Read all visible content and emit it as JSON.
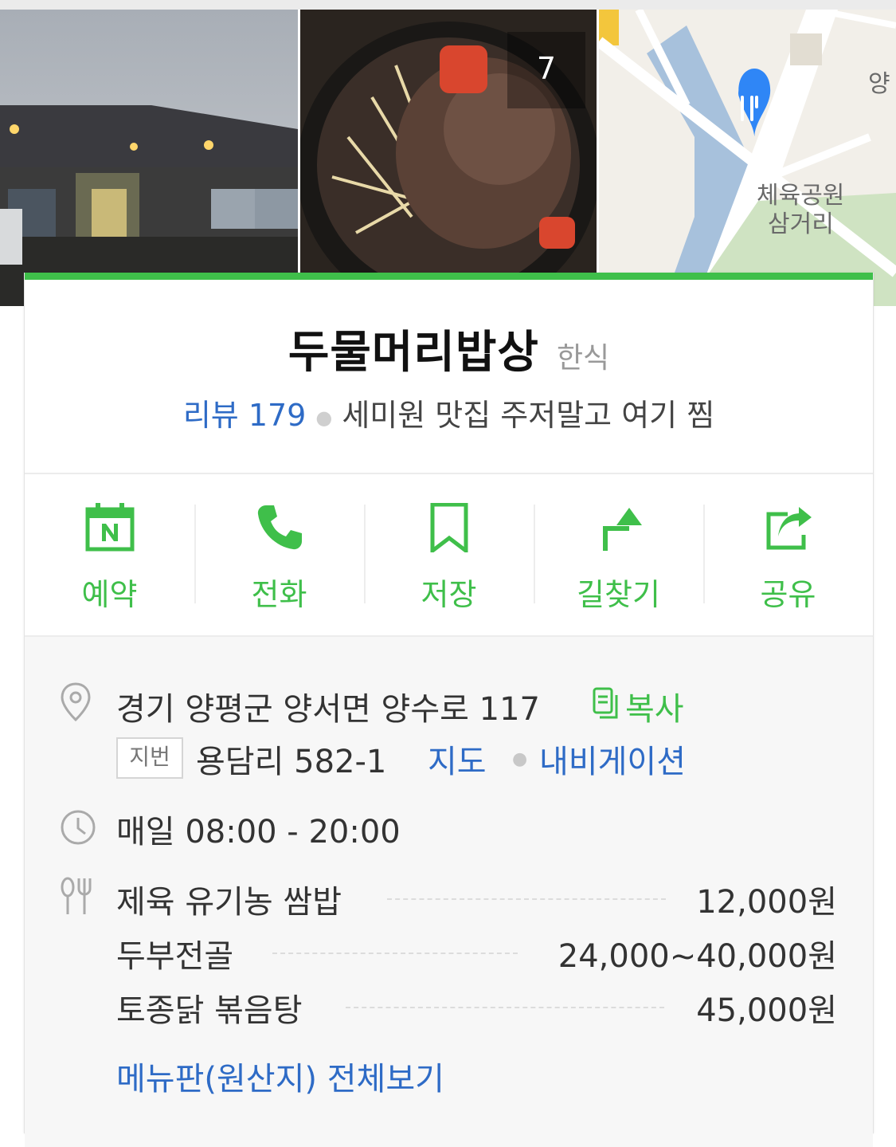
{
  "photos": {
    "count": "7",
    "map_labels": [
      "체육공원",
      "삼거리",
      "양"
    ]
  },
  "place": {
    "name": "두물머리밥상",
    "category": "한식",
    "review_link": "리뷰 179",
    "tagline": "세미원 맛집 주저말고 여기 찜"
  },
  "actions": [
    {
      "label": "예약",
      "icon": "naver-calendar-icon"
    },
    {
      "label": "전화",
      "icon": "phone-icon"
    },
    {
      "label": "저장",
      "icon": "bookmark-icon"
    },
    {
      "label": "길찾기",
      "icon": "directions-icon"
    },
    {
      "label": "공유",
      "icon": "share-icon"
    }
  ],
  "info": {
    "address": "경기 양평군 양서면 양수로 117",
    "copy_label": "복사",
    "jibun_badge": "지번",
    "jibun_address": "용담리 582-1",
    "map_link": "지도",
    "navigation_link": "내비게이션",
    "hours": "매일 08:00 - 20:00",
    "menu": [
      {
        "name": "제육 유기농 쌈밥",
        "price": "12,000원"
      },
      {
        "name": "두부전골",
        "price": "24,000~40,000원"
      },
      {
        "name": "토종닭 볶음탕",
        "price": "45,000원"
      }
    ],
    "menu_full_link": "메뉴판(원산지) 전체보기"
  },
  "colors": {
    "accent_green": "#3fbf4a",
    "link_blue": "#2e6bc6",
    "map_pin_blue": "#2f86f6"
  }
}
